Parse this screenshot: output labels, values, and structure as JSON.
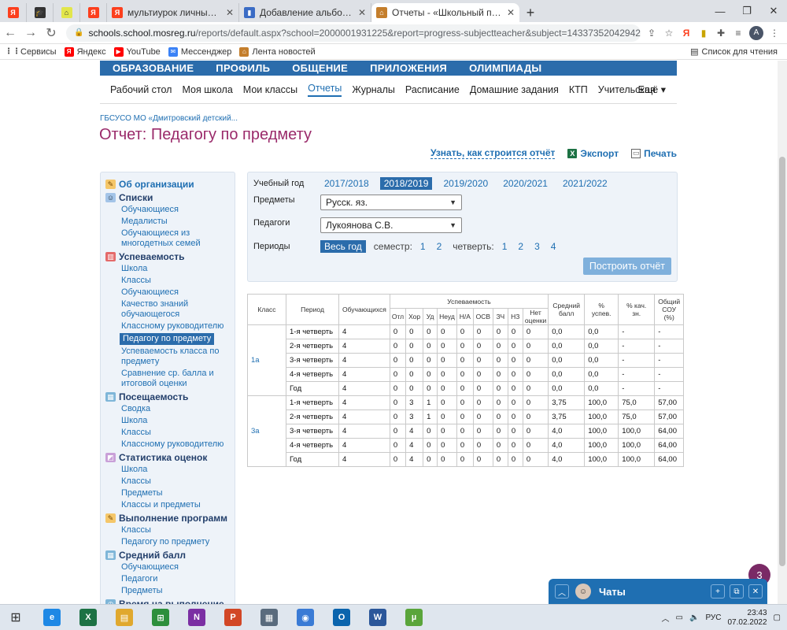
{
  "browser": {
    "tabs": [
      {
        "title": "",
        "icon": "yandex-icon",
        "style": "fav-y",
        "glyph": "Я"
      },
      {
        "title": "",
        "icon": "graduation-cap-icon",
        "style": "fav-grad",
        "glyph": "🎓"
      },
      {
        "title": "",
        "icon": "bookmark-tab-icon",
        "style": "fav-grn",
        "glyph": "⌂"
      },
      {
        "title": "",
        "icon": "yandex-icon",
        "style": "fav-y",
        "glyph": "Я"
      },
      {
        "title": "мультиурок личный кабинет вх",
        "icon": "yandex-icon",
        "style": "fav-y",
        "glyph": "Я"
      },
      {
        "title": "Добавление альбома",
        "icon": "book-icon",
        "style": "fav-blue",
        "glyph": "▮"
      },
      {
        "title": "Отчеты - «Школьный портал»",
        "icon": "school-portal-icon",
        "style": "fav-home",
        "glyph": "⌂",
        "active": true
      }
    ],
    "url_host": "schools.school.mosreg.ru",
    "url_rest": "/reports/default.aspx?school=2000001931225&report=progress-subjectteacher&subject=1433735204294274186&tea...",
    "profile_letter": "A"
  },
  "bookmarks": {
    "items": [
      {
        "label": "Сервисы",
        "icon": "apps-grid-icon",
        "style": "grid",
        "glyph": "⋮⋮"
      },
      {
        "label": "Яндекс",
        "icon": "yandex-icon",
        "style": "yt",
        "glyph": "Я"
      },
      {
        "label": "YouTube",
        "icon": "youtube-icon",
        "style": "yt",
        "glyph": "▶"
      },
      {
        "label": "Мессенджер",
        "icon": "messenger-icon",
        "style": "msg",
        "glyph": "✉"
      },
      {
        "label": "Лента новостей",
        "icon": "news-icon",
        "style": "news",
        "glyph": "⌂"
      }
    ],
    "reading_list": "Список для чтения"
  },
  "site": {
    "main_menu": [
      "ОБРАЗОВАНИЕ",
      "ПРОФИЛЬ",
      "ОБЩЕНИЕ",
      "ПРИЛОЖЕНИЯ",
      "ОЛИМПИАДЫ"
    ],
    "sub_nav": [
      "Рабочий стол",
      "Моя школа",
      "Мои классы",
      "Отчеты",
      "Журналы",
      "Расписание",
      "Домашние задания",
      "КТП",
      "Учительская"
    ],
    "sub_nav_active": 3,
    "more": "Ещё",
    "breadcrumb": "ГБСУСО МО «Дмитровский детский...",
    "page_title": "Отчет: Педагогу по предмету",
    "how_built": "Узнать, как строится отчёт",
    "export": "Экспорт",
    "print": "Печать"
  },
  "sidebar": {
    "sections": [
      {
        "title": "Об организации",
        "icon": "pencil-icon",
        "style": "s1",
        "glyph": "✎",
        "first": true,
        "items": []
      },
      {
        "title": "Списки",
        "icon": "users-icon",
        "style": "s2",
        "glyph": "☺",
        "items": [
          "Обучающиеся",
          "Медалисты",
          "Обучающиеся из многодетных семей"
        ]
      },
      {
        "title": "Успеваемость",
        "icon": "bar-chart-icon",
        "style": "s3",
        "glyph": "▥",
        "items": [
          "Школа",
          "Классы",
          "Обучающиеся",
          "Качество знаний обучающегося",
          "Классному руководителю",
          "Педагогу по предмету",
          "Успеваемость класса по предмету",
          "Сравнение ср. балла и итоговой оценки"
        ],
        "selected": 5
      },
      {
        "title": "Посещаемость",
        "icon": "calendar-icon",
        "style": "s4",
        "glyph": "▦",
        "items": [
          "Сводка",
          "Школа",
          "Классы",
          "Классному руководителю"
        ]
      },
      {
        "title": "Статистика оценок",
        "icon": "stats-icon",
        "style": "s5",
        "glyph": "◩",
        "items": [
          "Школа",
          "Классы",
          "Предметы",
          "Классы и предметы"
        ]
      },
      {
        "title": "Выполнение программ",
        "icon": "pencil-icon",
        "style": "s6",
        "glyph": "✎",
        "items": [
          "Классы",
          "Педагогу по предмету"
        ]
      },
      {
        "title": "Средний балл",
        "icon": "calendar-icon",
        "style": "s7",
        "glyph": "▦",
        "items": [
          "Обучающиеся",
          "Педагоги",
          "Предметы"
        ]
      },
      {
        "title": "Время на выполнение",
        "icon": "clock-icon",
        "style": "s4",
        "glyph": "◷",
        "items": []
      }
    ]
  },
  "filters": {
    "year_label": "Учебный год",
    "years": [
      "2017/2018",
      "2018/2019",
      "2019/2020",
      "2020/2021",
      "2021/2022"
    ],
    "year_selected": 1,
    "subjects_label": "Предметы",
    "subject_value": "Русск. яз.",
    "teachers_label": "Педагоги",
    "teacher_value": "Лукоянова С.В.",
    "periods_label": "Периоды",
    "period_all": "Весь год",
    "semester_label": "семестр:",
    "semesters": [
      "1",
      "2"
    ],
    "quarter_label": "четверть:",
    "quarters": [
      "1",
      "2",
      "3",
      "4"
    ],
    "build_button": "Построить отчёт"
  },
  "report": {
    "headers": {
      "class": "Класс",
      "period": "Период",
      "students": "Обучающихся",
      "progress": "Успеваемость",
      "sub": [
        "Отл",
        "Хор",
        "Уд",
        "Неуд",
        "Н/А",
        "ОСВ",
        "ЗЧ",
        "НЗ",
        "Нет оценки"
      ],
      "avg": "Средний балл",
      "pct_pass": "% успев.",
      "pct_quality": "% кач. зн.",
      "sou": "Общий СОУ (%)"
    },
    "groups": [
      {
        "class": "1а",
        "rows": [
          [
            "1-я четверть",
            "4",
            "0",
            "0",
            "0",
            "0",
            "0",
            "0",
            "0",
            "0",
            "0",
            "0,0",
            "0,0",
            "-",
            "-"
          ],
          [
            "2-я четверть",
            "4",
            "0",
            "0",
            "0",
            "0",
            "0",
            "0",
            "0",
            "0",
            "0",
            "0,0",
            "0,0",
            "-",
            "-"
          ],
          [
            "3-я четверть",
            "4",
            "0",
            "0",
            "0",
            "0",
            "0",
            "0",
            "0",
            "0",
            "0",
            "0,0",
            "0,0",
            "-",
            "-"
          ],
          [
            "4-я четверть",
            "4",
            "0",
            "0",
            "0",
            "0",
            "0",
            "0",
            "0",
            "0",
            "0",
            "0,0",
            "0,0",
            "-",
            "-"
          ],
          [
            "Год",
            "4",
            "0",
            "0",
            "0",
            "0",
            "0",
            "0",
            "0",
            "0",
            "0",
            "0,0",
            "0,0",
            "-",
            "-"
          ]
        ]
      },
      {
        "class": "3а",
        "rows": [
          [
            "1-я четверть",
            "4",
            "0",
            "3",
            "1",
            "0",
            "0",
            "0",
            "0",
            "0",
            "0",
            "3,75",
            "100,0",
            "75,0",
            "57,00"
          ],
          [
            "2-я четверть",
            "4",
            "0",
            "3",
            "1",
            "0",
            "0",
            "0",
            "0",
            "0",
            "0",
            "3,75",
            "100,0",
            "75,0",
            "57,00"
          ],
          [
            "3-я четверть",
            "4",
            "0",
            "4",
            "0",
            "0",
            "0",
            "0",
            "0",
            "0",
            "0",
            "4,0",
            "100,0",
            "100,0",
            "64,00"
          ],
          [
            "4-я четверть",
            "4",
            "0",
            "4",
            "0",
            "0",
            "0",
            "0",
            "0",
            "0",
            "0",
            "4,0",
            "100,0",
            "100,0",
            "64,00"
          ],
          [
            "Год",
            "4",
            "0",
            "4",
            "0",
            "0",
            "0",
            "0",
            "0",
            "0",
            "0",
            "4,0",
            "100,0",
            "100,0",
            "64,00"
          ]
        ]
      }
    ]
  },
  "chat": {
    "badge": "3",
    "title": "Чаты"
  },
  "taskbar": {
    "apps": [
      {
        "icon": "internet-explorer-icon",
        "color": "#1e88e5",
        "glyph": "e"
      },
      {
        "icon": "excel-icon",
        "color": "#1d7244",
        "glyph": "X"
      },
      {
        "icon": "file-explorer-icon",
        "color": "#e0a82e",
        "glyph": "▤"
      },
      {
        "icon": "store-icon",
        "color": "#2d8f3c",
        "glyph": "⊞"
      },
      {
        "icon": "onenote-icon",
        "color": "#7b2fa3",
        "glyph": "N"
      },
      {
        "icon": "powerpoint-icon",
        "color": "#d24726",
        "glyph": "P"
      },
      {
        "icon": "calculator-icon",
        "color": "#5a6b7d",
        "glyph": "▦"
      },
      {
        "icon": "chrome-icon",
        "color": "#3a7bd5",
        "glyph": "◉"
      },
      {
        "icon": "outlook-icon",
        "color": "#0a64ad",
        "glyph": "O"
      },
      {
        "icon": "word-icon",
        "color": "#2b579a",
        "glyph": "W"
      },
      {
        "icon": "utorrent-icon",
        "color": "#5aa53b",
        "glyph": "µ"
      }
    ],
    "lang": "РУС",
    "time": "23:43",
    "date": "07.02.2022"
  }
}
